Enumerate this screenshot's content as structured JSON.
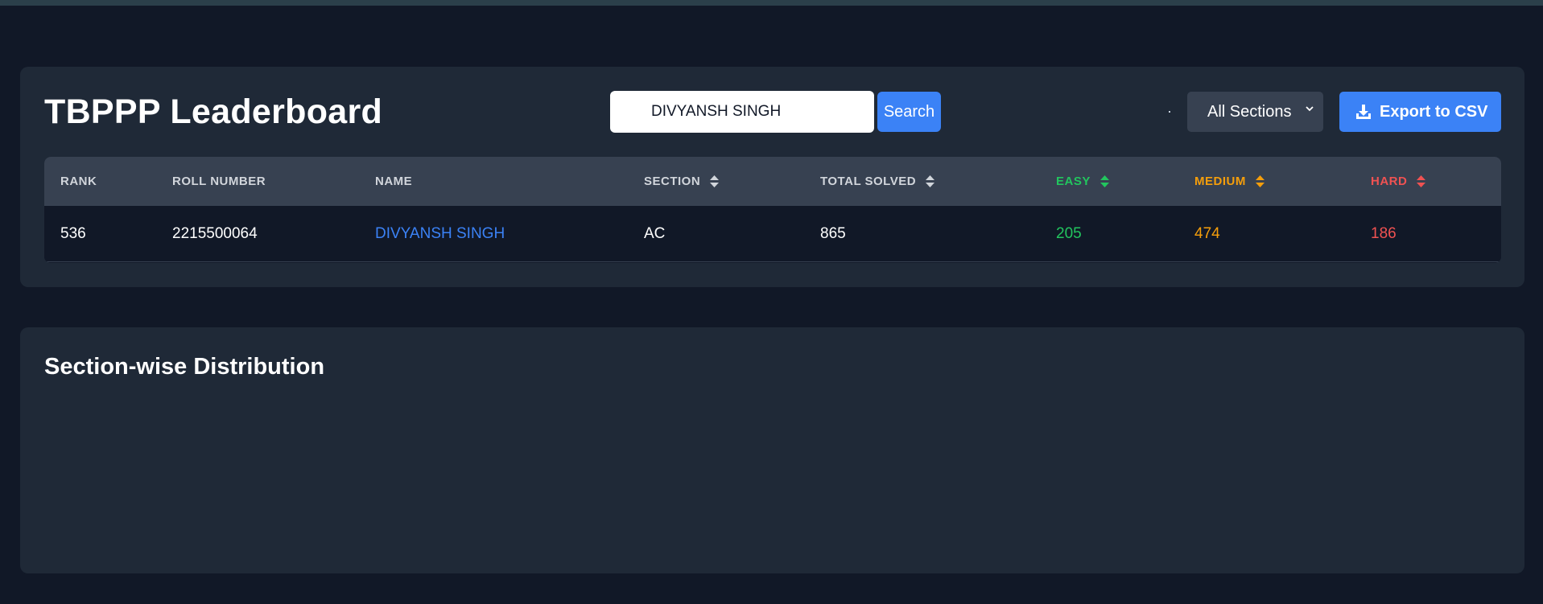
{
  "leaderboard": {
    "title": "TBPPP Leaderboard",
    "search": {
      "value": "DIVYANSH SINGH",
      "button_label": "Search"
    },
    "section_filter": {
      "selected": "All Sections"
    },
    "export_label": "Export to CSV",
    "columns": {
      "rank": "RANK",
      "roll_number": "ROLL NUMBER",
      "name": "NAME",
      "section": "SECTION",
      "total_solved": "TOTAL SOLVED",
      "easy": "EASY",
      "medium": "MEDIUM",
      "hard": "HARD"
    },
    "rows": [
      {
        "rank": "536",
        "roll_number": "2215500064",
        "name": "DIVYANSH SINGH",
        "section": "AC",
        "total_solved": "865",
        "easy": "205",
        "medium": "474",
        "hard": "186"
      }
    ]
  },
  "distribution": {
    "title": "Section-wise Distribution"
  },
  "colors": {
    "background": "#111827",
    "card": "#1f2937",
    "accent": "#3b82f6",
    "easy": "#22c55e",
    "medium": "#f59e0b",
    "hard": "#f05252"
  }
}
